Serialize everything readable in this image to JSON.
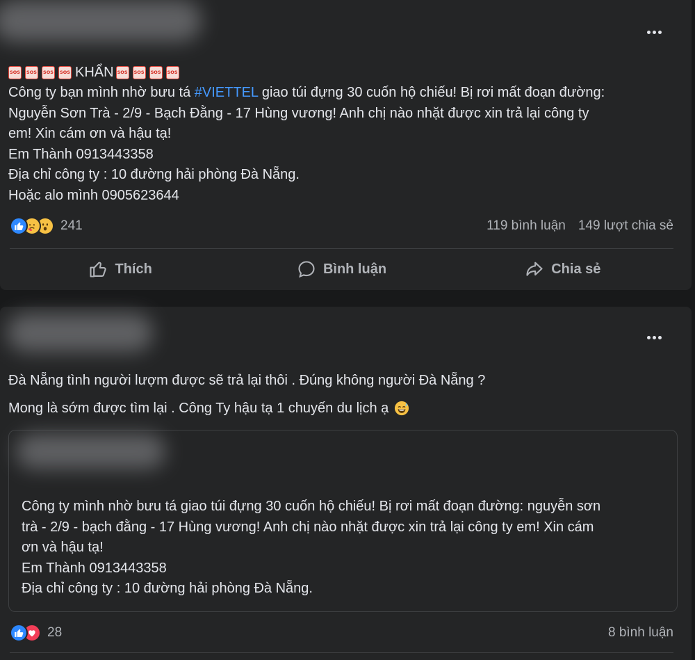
{
  "post1": {
    "headline_word": "KHẨN",
    "sos_label": "SOS",
    "text_before_hashtag": "Công ty bạn mình nhờ bưu tá ",
    "hashtag": "#VIETTEL",
    "text_after_hashtag": " giao túi đựng 30 cuốn hộ chiếu! Bị rơi mất đoạn đường:",
    "lines": [
      "Nguyễn Sơn Trà - 2/9 - Bạch Đằng - 17 Hùng vương! Anh chị nào nhặt được xin trả lại công ty",
      "em! Xin cám ơn và hậu tạ!",
      "Em Thành 0913443358",
      "Địa chỉ công ty : 10 đường hải phòng Đà Nẵng.",
      "Hoặc alo mình 0905623644"
    ],
    "reaction_count": "241",
    "comments": "119 bình luận",
    "shares": "149 lượt chia sẻ",
    "actions": {
      "like": "Thích",
      "comment": "Bình luận",
      "share": "Chia sẻ"
    }
  },
  "post2": {
    "lines": [
      "Đà Nẵng tình người lượm được sẽ trả lại thôi . Đúng không người Đà Nẵng ?",
      "Mong là sớm được tìm lại . Công Ty hậu tạ 1 chuyến du lịch ạ"
    ],
    "shared_lines": [
      "Công ty mình nhờ bưu tá giao túi đựng 30 cuốn hộ chiếu! Bị rơi mất đoạn đường: nguyễn sơn",
      "trà - 2/9 - bạch đằng - 17 Hùng vương! Anh chị nào nhặt được xin trả lại công ty em! Xin cám",
      "ơn và hậu tạ!",
      "Em Thành 0913443358",
      "Địa chỉ công ty : 10 đường hải phòng Đà Nẵng."
    ],
    "reaction_count": "28",
    "comments": "8 bình luận"
  },
  "icons": {
    "more": "more-horizontal-icon",
    "like": "thumbs-up-icon",
    "comment": "speech-bubble-icon",
    "share": "share-arrow-icon",
    "sos": "sos-emoji-icon",
    "smile": "sweat-smile-emoji-icon"
  },
  "colors": {
    "background": "#18191a",
    "card": "#242526",
    "text": "#e4e6eb",
    "secondary_text": "#b0b3b8",
    "hashtag": "#4599ff",
    "like_blue": "#2d88ff",
    "love_red": "#f33e58",
    "haha_yellow": "#f7c144"
  }
}
